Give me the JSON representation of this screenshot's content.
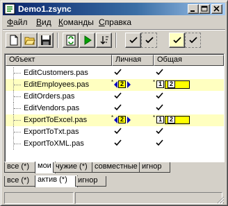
{
  "window": {
    "title": "Demo1.zsync"
  },
  "menu": [
    {
      "label": "Файл",
      "accel": "Ф",
      "rest": "айл"
    },
    {
      "label": "Вид",
      "accel": "В",
      "rest": "ид"
    },
    {
      "label": "Команды",
      "accel": "К",
      "rest": "оманды"
    },
    {
      "label": "Справка",
      "accel": "С",
      "rest": "правка"
    }
  ],
  "toolbar": {
    "buttons": [
      "new-file-icon",
      "open-folder-icon",
      "save-icon",
      "sync-icon",
      "run-icon",
      "sort-icon"
    ],
    "filters": [
      "check-personal",
      "check-personal-filled",
      "check-shared",
      "check-shared-filled"
    ]
  },
  "list": {
    "columns": [
      "Объект",
      "Личная",
      "Общая"
    ],
    "rows": [
      {
        "name": "EditCustomers.pas",
        "personal": "check",
        "shared": "check",
        "highlight": false
      },
      {
        "name": "EditEmployees.pas",
        "personal": "version-2",
        "shared": "version-1-2",
        "highlight": true
      },
      {
        "name": "EditOrders.pas",
        "personal": "check",
        "shared": "check",
        "highlight": false
      },
      {
        "name": "EditVendors.pas",
        "personal": "check",
        "shared": "check",
        "highlight": false
      },
      {
        "name": "ExportToExcel.pas",
        "personal": "version-2",
        "shared": "version-1-2",
        "highlight": true
      },
      {
        "name": "ExportToTxt.pas",
        "personal": "check",
        "shared": "check",
        "highlight": false
      },
      {
        "name": "ExportToXML.pas",
        "personal": "check",
        "shared": "check",
        "highlight": false
      }
    ],
    "version_labels": {
      "a": "2",
      "b": "1"
    }
  },
  "tabs_top": [
    "все (*)",
    "мои",
    "чужие (*)",
    "совместные",
    "игнор"
  ],
  "tabs_top_active": 1,
  "tabs_bottom": [
    "все (*)",
    "актив (*)",
    "игнор"
  ],
  "tabs_bottom_active": 1,
  "colors": {
    "highlight": "#ffffc0",
    "title_start": "#0a246a",
    "marker_yellow": "#ffff00",
    "marker_blue": "#0000c0"
  }
}
